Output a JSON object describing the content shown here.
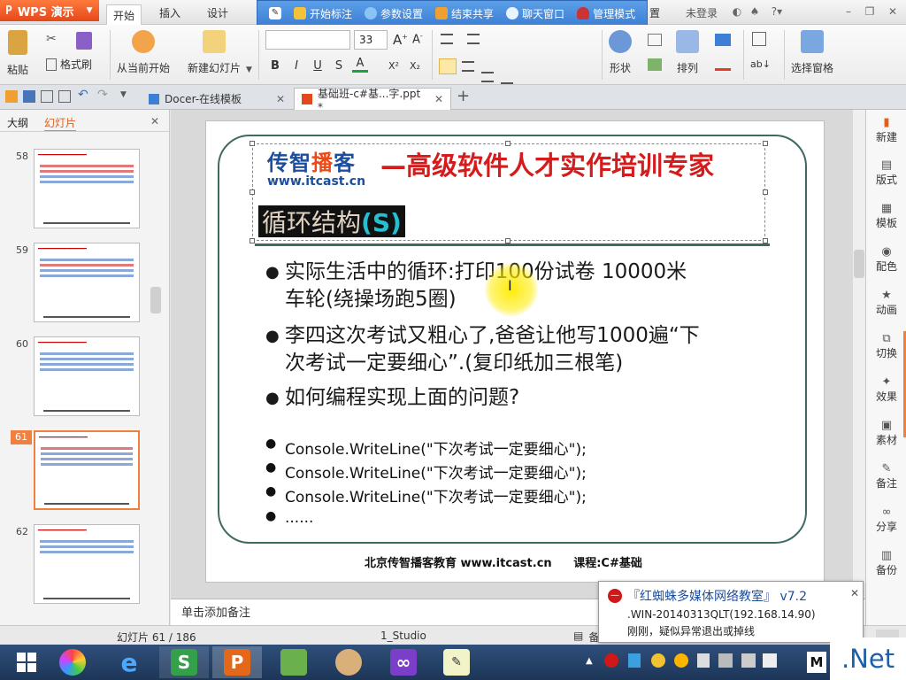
{
  "app": {
    "logo_label": "WPS 演示",
    "menu": {
      "start": "开始",
      "insert": "插入",
      "design": "设计",
      "trail": "置"
    },
    "login": "未登录"
  },
  "floatbar": {
    "start_mark": "开始标注",
    "params": "参数设置",
    "end_share": "结束共享",
    "chat": "聊天窗口",
    "admin": "管理模式"
  },
  "ribbon": {
    "paste": "粘贴",
    "cut": "剪切",
    "copy": "复制",
    "format_painter": "格式刷",
    "from_current": "从当前开始",
    "new_slide": "新建幻灯片",
    "font_size": "33",
    "shape": "形状",
    "arrange": "排列",
    "select_pane": "选择窗格"
  },
  "tabs": {
    "docer": "Docer-在线模板",
    "ppt": "基础班-c#基...字.ppt *"
  },
  "left_panel": {
    "outline_tab": "大纲",
    "slides_tab": "幻灯片",
    "thumbnails": [
      {
        "num": "58",
        "selected": false
      },
      {
        "num": "59",
        "selected": false
      },
      {
        "num": "60",
        "selected": false
      },
      {
        "num": "61",
        "selected": true
      },
      {
        "num": "62",
        "selected": false
      }
    ]
  },
  "slide": {
    "logo_cn_a": "传智",
    "logo_cn_b": "播",
    "logo_cn_c": "客",
    "logo_url": "www.itcast.cn",
    "tagline": "—高级软件人才实作培训专家",
    "title": "循环结构",
    "title_s": "(S)",
    "bullets": [
      {
        "line1": "实际生活中的循环:打印100份试卷  10000米",
        "line2": "车轮(绕操场跑5圈)"
      },
      {
        "line1": "李四这次考试又粗心了,爸爸让他写1000遍“下",
        "line2": "次考试一定要细心”.(复印纸加三根笔)"
      },
      {
        "line1": "如何编程实现上面的问题?",
        "line2": ""
      }
    ],
    "code_lines": [
      "Console.WriteLine(\"下次考试一定要细心\");",
      "Console.WriteLine(\"下次考试一定要细心\");",
      "Console.WriteLine(\"下次考试一定要细心\");",
      "......"
    ],
    "footer_left": "北京传智播客教育 www.itcast.cn",
    "footer_right": "课程:C#基础"
  },
  "notes_placeholder": "单击添加备注",
  "right_panel": [
    "新建",
    "版式",
    "模板",
    "配色",
    "动画",
    "切换",
    "效果",
    "素材",
    "备注",
    "分享",
    "备份"
  ],
  "status": {
    "slide_count": "幻灯片 61 / 186",
    "theme": "1_Studio",
    "trail": "备"
  },
  "popup": {
    "title": "『红蜘蛛多媒体网络教室』 v7.2",
    "line1": ".WIN-20140313QLT(192.168.14.90)",
    "line2": "刚刚，疑似异常退出或掉线"
  },
  "taskbar": {
    "net_label": ".Net",
    "input_method": "M"
  },
  "colors": {
    "accent": "#e5481a",
    "float_bar": "#3d7fd4",
    "tagline": "#d41c1c",
    "frame": "#3e6a64"
  }
}
